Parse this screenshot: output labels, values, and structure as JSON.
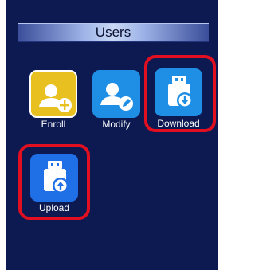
{
  "header": {
    "title": "Users"
  },
  "menu": {
    "items": [
      {
        "id": "enroll",
        "label": "Enroll",
        "icon": "user-add-icon",
        "color": "#e8c020"
      },
      {
        "id": "modify",
        "label": "Modify",
        "icon": "user-edit-icon",
        "color": "#1f8fe6"
      },
      {
        "id": "download",
        "label": "Download",
        "icon": "usb-download-icon",
        "color": "#1f8fe6"
      },
      {
        "id": "upload",
        "label": "Upload",
        "icon": "usb-upload-icon",
        "color": "#1f6fe6"
      }
    ]
  },
  "colors": {
    "background": "#0d1a52",
    "highlight": "#e10f1f"
  }
}
